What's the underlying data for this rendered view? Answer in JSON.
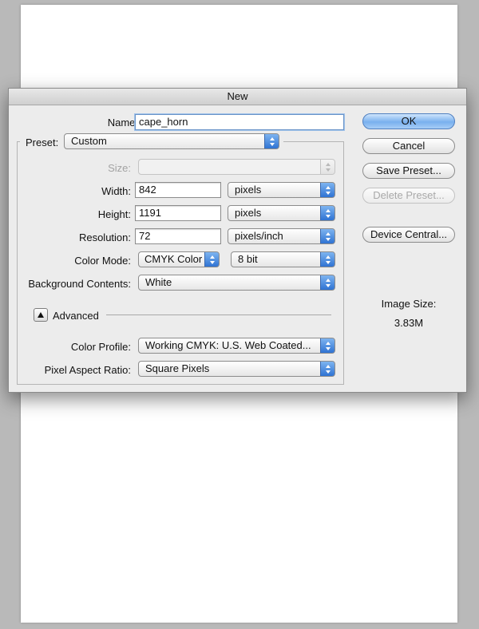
{
  "dialog": {
    "title": "New",
    "name_label": "Name:",
    "name_value": "cape_horn",
    "preset_label": "Preset:",
    "preset_value": "Custom",
    "size_label": "Size:",
    "size_value": "",
    "width_label": "Width:",
    "width_value": "842",
    "width_unit": "pixels",
    "height_label": "Height:",
    "height_value": "1191",
    "height_unit": "pixels",
    "resolution_label": "Resolution:",
    "resolution_value": "72",
    "resolution_unit": "pixels/inch",
    "color_mode_label": "Color Mode:",
    "color_mode_value": "CMYK Color",
    "bit_depth_value": "8 bit",
    "background_label": "Background Contents:",
    "background_value": "White",
    "advanced_label": "Advanced",
    "color_profile_label": "Color Profile:",
    "color_profile_value": "Working CMYK:  U.S. Web Coated...",
    "pixel_aspect_label": "Pixel Aspect Ratio:",
    "pixel_aspect_value": "Square Pixels",
    "buttons": {
      "ok": "OK",
      "cancel": "Cancel",
      "save_preset": "Save Preset...",
      "delete_preset": "Delete Preset...",
      "device_central": "Device Central..."
    },
    "image_size_label": "Image Size:",
    "image_size_value": "3.83M"
  },
  "colors": {
    "accent": "#5a9be8",
    "desktop": "#b9b9b9",
    "dialog_bg": "#ececec"
  }
}
